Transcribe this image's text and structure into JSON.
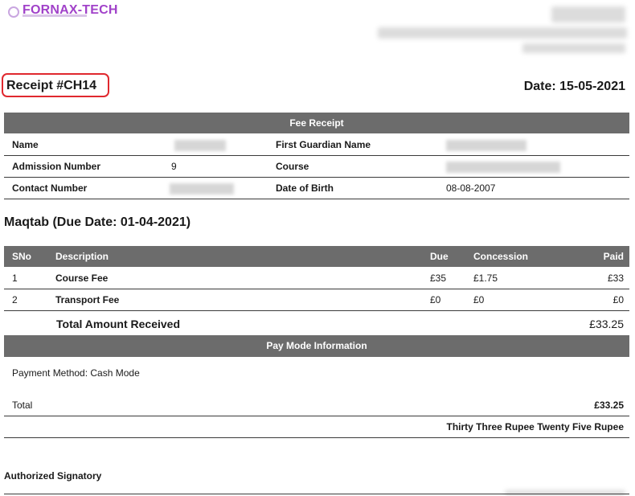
{
  "brand": {
    "name": "FORNAX-TECH"
  },
  "receipt": {
    "title": "Receipt #CH14",
    "date_label": "Date: 15-05-2021"
  },
  "fee_receipt": {
    "header": "Fee Receipt",
    "rows": [
      {
        "label1": "Name",
        "value1": "",
        "label2": "First Guardian Name",
        "value2": ""
      },
      {
        "label1": "Admission Number",
        "value1": "9",
        "label2": "Course",
        "value2": ""
      },
      {
        "label1": "Contact Number",
        "value1": "",
        "label2": "Date of Birth",
        "value2": "08-08-2007"
      }
    ]
  },
  "section": {
    "title": "Maqtab (Due Date: 01-04-2021)"
  },
  "fees_table": {
    "columns": [
      "SNo",
      "Description",
      "Due",
      "Concession",
      "Paid"
    ],
    "rows": [
      {
        "sno": "1",
        "description": "Course Fee",
        "due": "£35",
        "concession": "£1.75",
        "paid": "£33"
      },
      {
        "sno": "2",
        "description": "Transport Fee",
        "due": "£0",
        "concession": "£0",
        "paid": "£0"
      }
    ],
    "total_label": "Total Amount Received",
    "total_value": "£33.25"
  },
  "pay_mode": {
    "header": "Pay Mode Information",
    "method": "Payment Method: Cash Mode",
    "total_label": "Total",
    "total_value": "£33.25",
    "amount_words": "Thirty Three Rupee Twenty Five Rupee"
  },
  "signature": {
    "label": "Authorized Signatory"
  },
  "colors": {
    "header_bar": "#6c6c6c",
    "highlight": "#e0282e",
    "brand": "#a142c9"
  }
}
